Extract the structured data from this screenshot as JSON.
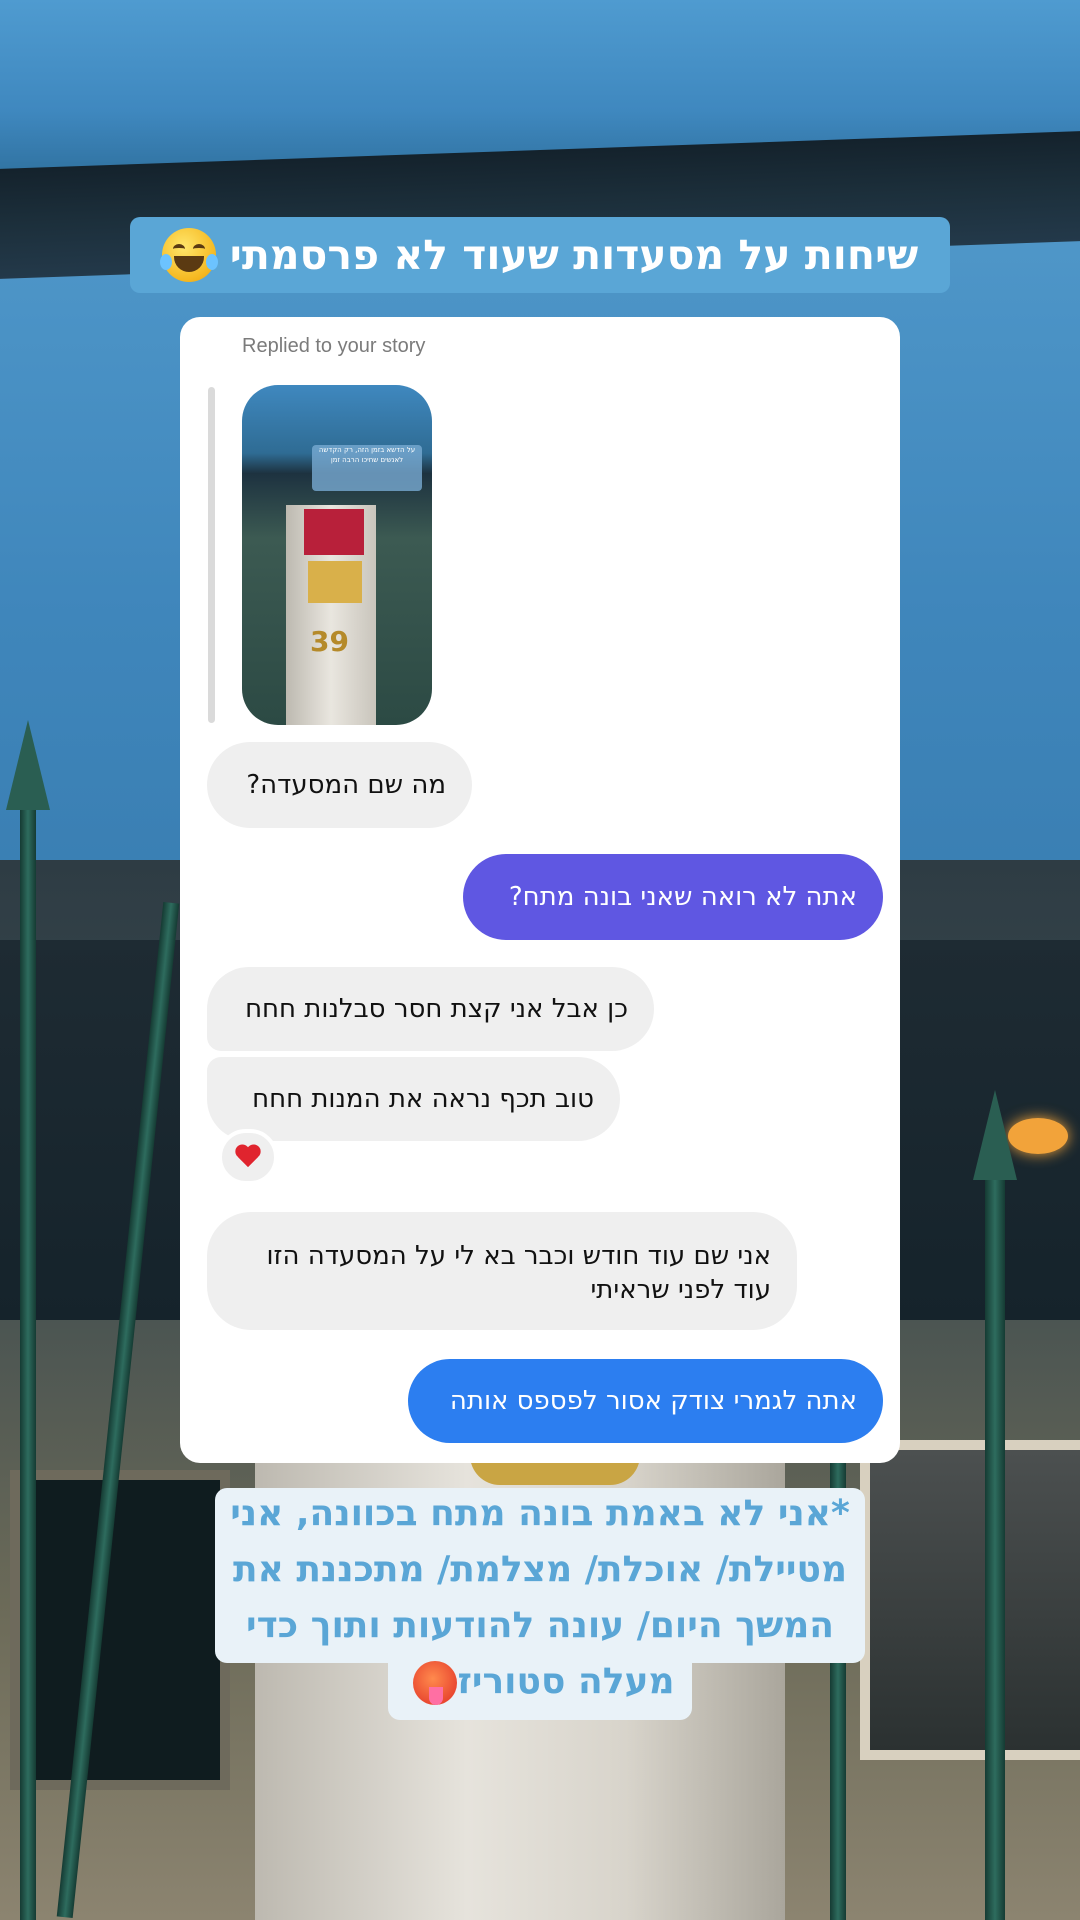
{
  "story": {
    "title": "שיחות על מסעדות שעוד לא פרסמתי",
    "title_emoji": "face-with-tears-of-joy"
  },
  "dm": {
    "reply_label": "Replied to your story",
    "story_thumbnail": {
      "caption": "על הדשא בזמן הזה, רק הקדשה לאנשים שחיכו הרבה זמן",
      "house_number": "39"
    },
    "messages": [
      {
        "from": "them",
        "text": "מה שם המסעדה?"
      },
      {
        "from": "me",
        "text": "אתה לא רואה שאני בונה מתח?"
      },
      {
        "from": "them",
        "text": "כן אבל אני קצת חסר סבלנות חחח"
      },
      {
        "from": "them",
        "text": "טוב תכף נראה את המנות חחח",
        "reaction": "red-heart"
      },
      {
        "from": "them",
        "text": "אני שם עוד חודש וכבר בא לי על המסעדה הזו עוד לפני שראיתי"
      },
      {
        "from": "me",
        "text": "אתה לגמרי צודק אסור לפספס אותה"
      }
    ],
    "colors": {
      "outgoing_purple": "#5f57e2",
      "outgoing_blue": "#2c7ef0",
      "incoming_gray": "#efefef"
    }
  },
  "note": {
    "line1": "*אני לא באמת בונה מתח בכוונה, אני",
    "line2": "מטיילת/ אוכלת/ מצלמת/ מתכננת את",
    "line3": "המשך היום/ עונה להודעות ותוך כדי",
    "line4": "מעלה סטוריז",
    "emoji": "hot-face"
  }
}
